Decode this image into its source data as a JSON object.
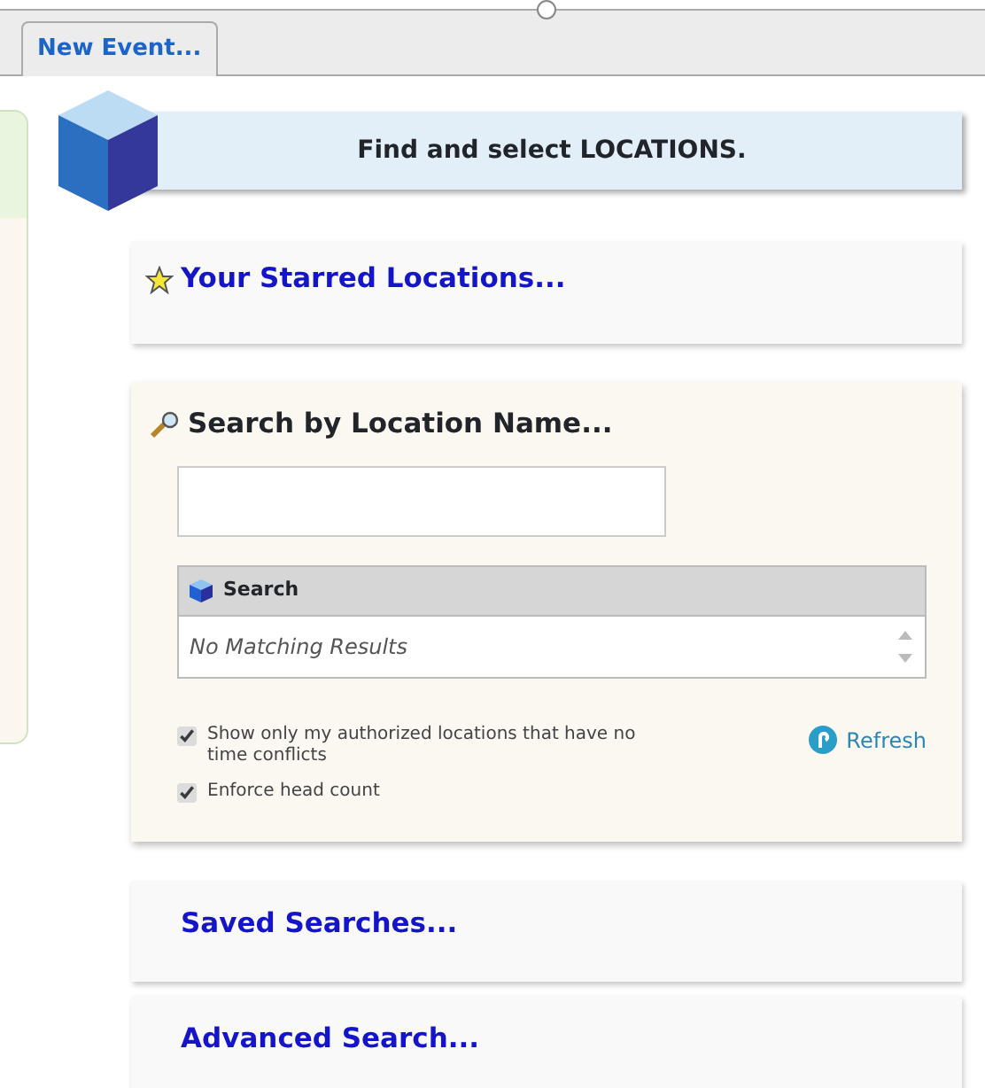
{
  "tabs": [
    {
      "label": "New Event...",
      "selected": true
    }
  ],
  "banner": {
    "title": "Find and select LOCATIONS."
  },
  "starred": {
    "title": "Your Starred Locations..."
  },
  "search_section": {
    "title": "Search by Location Name...",
    "results": {
      "header": "Search",
      "empty_text": "No Matching Results"
    },
    "options": [
      {
        "label": "Show only my authorized locations that have no time conflicts",
        "checked": true
      },
      {
        "label": "Enforce head count",
        "checked": true
      }
    ],
    "refresh": "Refresh"
  },
  "links": [
    {
      "label": "Saved Searches..."
    },
    {
      "label": "Advanced Search..."
    }
  ]
}
